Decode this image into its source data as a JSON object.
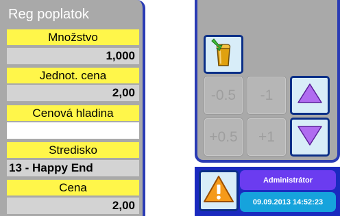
{
  "form": {
    "title": "Reg poplatok",
    "fields": [
      {
        "label": "Množstvo",
        "value": "1,000"
      },
      {
        "label": "Jednot. cena",
        "value": "2,00"
      },
      {
        "label": "Cenová hladina",
        "value": ""
      },
      {
        "label": "Stredisko",
        "value": "13 - Happy End"
      },
      {
        "label": "Cena",
        "value": "2,00"
      }
    ]
  },
  "keypad": {
    "bag_icon": "shopping-bag-icon",
    "buttons": {
      "minus_half": "-0.5",
      "minus_one": "-1",
      "plus_half": "+0.5",
      "plus_one": "+1"
    },
    "up_icon": "triangle-up-icon",
    "down_icon": "triangle-down-icon"
  },
  "status": {
    "user": "Administrátor",
    "datetime": "09.09.2013 14:52:23",
    "warning_icon": "warning-icon"
  },
  "colors": {
    "accent_blue": "#2a3bb4",
    "label_yellow": "#fff64a",
    "user_badge": "#6b3cf0",
    "datetime_badge": "#16a3dc",
    "arrow_violet": "#b06cf0"
  }
}
